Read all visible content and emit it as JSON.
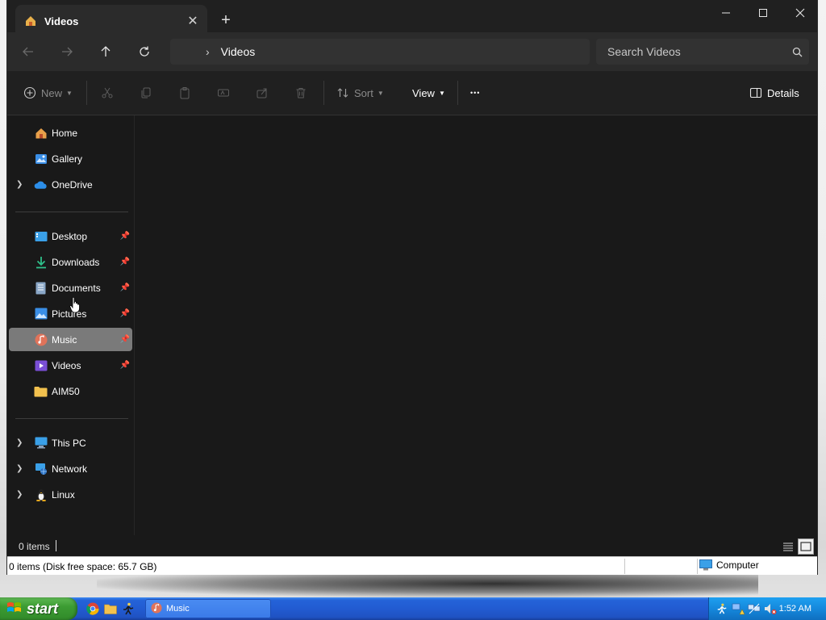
{
  "window": {
    "tab_title": "Videos",
    "new_tab_symbol": "+",
    "close_tab_symbol": "✕"
  },
  "navigation": {
    "breadcrumb": "Videos",
    "search_placeholder": "Search Videos"
  },
  "toolbar": {
    "new_label": "New",
    "sort_label": "Sort",
    "view_label": "View",
    "more_symbol": "•••",
    "details_label": "Details"
  },
  "sidebar": {
    "items": [
      {
        "label": "Home",
        "icon": "home-icon",
        "expandable": false,
        "pinned": false
      },
      {
        "label": "Gallery",
        "icon": "gallery-icon",
        "expandable": false,
        "pinned": false
      },
      {
        "label": "OneDrive",
        "icon": "onedrive-icon",
        "expandable": true,
        "pinned": false
      },
      {
        "label": "Desktop",
        "icon": "desktop-icon",
        "expandable": false,
        "pinned": true
      },
      {
        "label": "Downloads",
        "icon": "downloads-icon",
        "expandable": false,
        "pinned": true
      },
      {
        "label": "Documents",
        "icon": "documents-icon",
        "expandable": false,
        "pinned": true
      },
      {
        "label": "Pictures",
        "icon": "pictures-icon",
        "expandable": false,
        "pinned": true
      },
      {
        "label": "Music",
        "icon": "music-icon",
        "expandable": false,
        "pinned": true,
        "selected": true
      },
      {
        "label": "Videos",
        "icon": "videos-icon",
        "expandable": false,
        "pinned": true
      },
      {
        "label": "AIM50",
        "icon": "folder-icon",
        "expandable": false,
        "pinned": false
      },
      {
        "label": "This PC",
        "icon": "this-pc-icon",
        "expandable": true,
        "pinned": false
      },
      {
        "label": "Network",
        "icon": "network-icon",
        "expandable": true,
        "pinned": false
      },
      {
        "label": "Linux",
        "icon": "linux-icon",
        "expandable": true,
        "pinned": false
      }
    ]
  },
  "status": {
    "item_count": "0 items",
    "disk_info": "0 items (Disk free space: 65.7 GB)",
    "zone_label": "Computer"
  },
  "taskbar": {
    "start_label": "start",
    "task_label": "Music",
    "clock": "1:52 AM"
  },
  "colors": {
    "window_bg": "#191919",
    "selected_item": "#7a7a7a",
    "taskbar_blue": "#225bd1",
    "start_green": "#3c9c33"
  }
}
